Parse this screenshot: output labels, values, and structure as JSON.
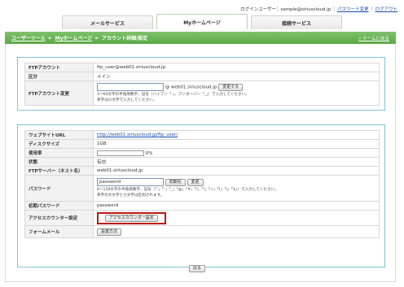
{
  "header": {
    "login_label": "ログインユーザー：sample@siriuscloud.jp",
    "change_password": "パスワード変更",
    "logout": "ログアウト",
    "separator": "|"
  },
  "tabs": [
    {
      "label": "メールサービス"
    },
    {
      "label": "Myホームページ"
    },
    {
      "label": "接続サービス"
    }
  ],
  "breadcrumb": {
    "items": [
      "ユーザーツール",
      "Myホームページ",
      "アカウント詳細/設定"
    ],
    "arrow": "►",
    "home_link": "« ホームに戻る"
  },
  "ftp_section": {
    "rows": [
      {
        "label": "FTPアカウント",
        "value": "ftp_user@web01.siriuscloud.jp"
      },
      {
        "label": "区分",
        "value": "メイン"
      }
    ],
    "change_label": "FTPアカウント変更",
    "input_value": "",
    "domain_suffix": "@ web01.siriuscloud.jp",
    "change_button": "変更する",
    "note_line1": "3～64文字の半角英数字、記号（ハイフン「-」、アンダーバー「_」）で入力してください。",
    "note_line2": "英字は小文字で入力してください。"
  },
  "site_section": {
    "url_label": "ウェブサイトURL",
    "url_value": "http://web01.siriuscloud.jp/ftp_user/",
    "disk_label": "ディスクサイズ",
    "disk_value": "1GB",
    "usage_label": "使用率",
    "usage_percent": 0,
    "usage_text": "0%",
    "status_label": "状態",
    "status_value": "有効",
    "ftp_server_label": "FTPサーバー（ネスト名）",
    "ftp_server_value": "web01.siriuscloud.jp",
    "password_label": "パスワード",
    "password_value": "password",
    "init_button": "初期化",
    "change_button": "変更",
    "pw_note_line1": "6～128文字の半角英数字、記号（「.」「-」「_」「@」「#」「/」「!」「+」「(」「)」「$」）で入力してください。",
    "pw_note_line2": "英字の大文字と小文字は区別されます。",
    "initial_pw_label": "初期パスワード",
    "initial_pw_value": "password",
    "access_counter_label": "アクセスカウンター設定",
    "access_counter_button": "アクセスカウンター設定",
    "form_mail_label": "フォームメール",
    "form_mail_button": "設置方法"
  },
  "back_button": "戻る",
  "colors": {
    "brand_green": "#5aa845",
    "panel_border": "#7fc3d6",
    "highlight_red": "#c01818",
    "link_blue": "#1a4fb0"
  }
}
